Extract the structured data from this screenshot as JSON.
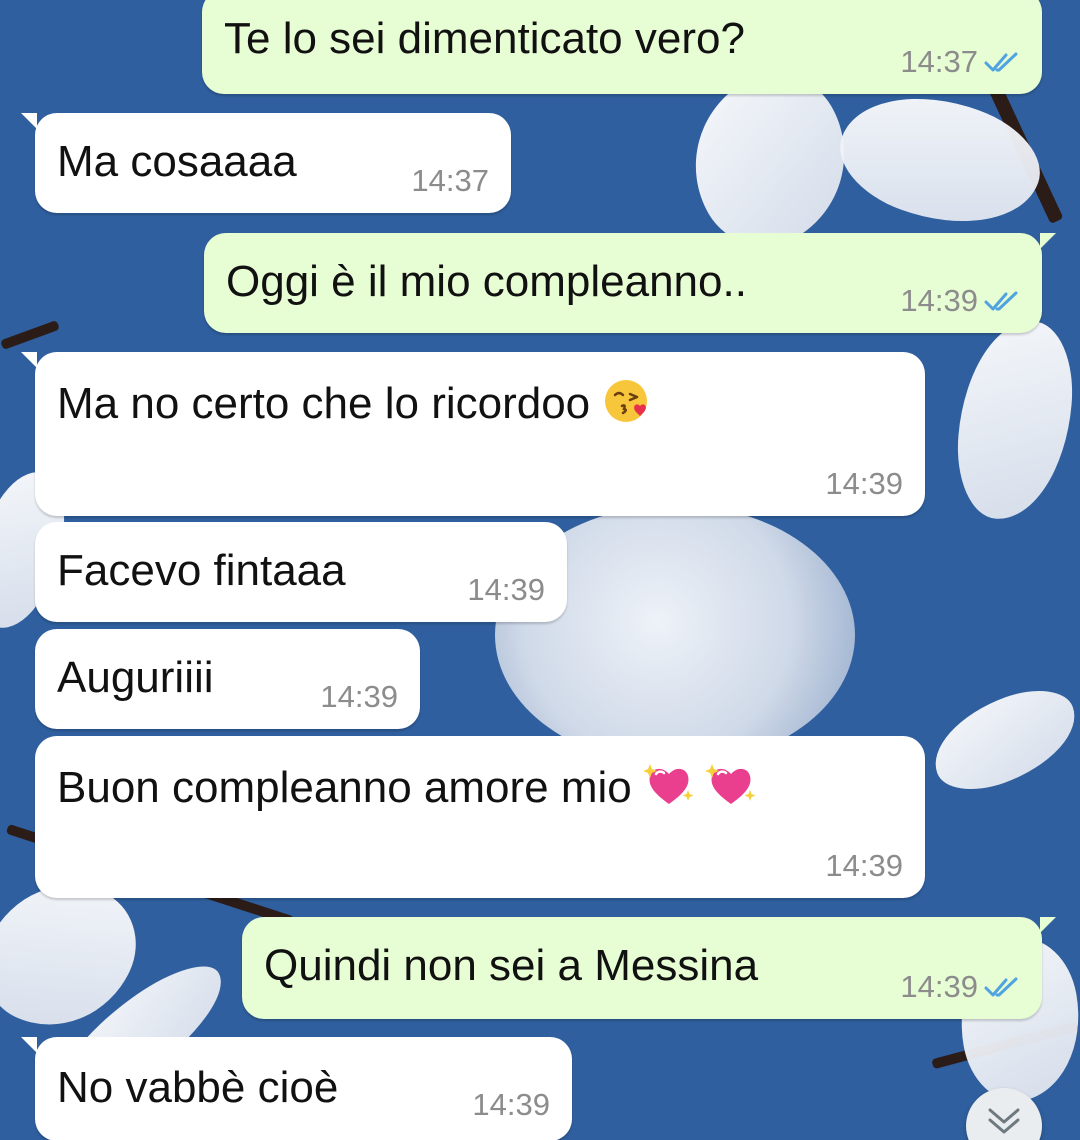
{
  "messages": [
    {
      "id": "m1",
      "direction": "outgoing",
      "text": "Te lo sei dimenticato vero?",
      "time": "14:37",
      "status": "read"
    },
    {
      "id": "m2",
      "direction": "incoming",
      "text": "Ma cosaaaa",
      "time": "14:37"
    },
    {
      "id": "m3",
      "direction": "outgoing",
      "text": "Oggi è il mio compleanno..",
      "time": "14:39",
      "status": "read"
    },
    {
      "id": "m4",
      "direction": "incoming",
      "text": "Ma no certo che lo ricordoo",
      "emoji": "face-blowing-kiss",
      "time": "14:39"
    },
    {
      "id": "m5",
      "direction": "incoming",
      "text": "Facevo fintaaa",
      "time": "14:39"
    },
    {
      "id": "m6",
      "direction": "incoming",
      "text": "Auguriiii",
      "time": "14:39"
    },
    {
      "id": "m7",
      "direction": "incoming",
      "text": "Buon compleanno amore mio",
      "emoji": "sparkling-heart x2",
      "time": "14:39"
    },
    {
      "id": "m8",
      "direction": "outgoing",
      "text": "Quindi non sei a Messina",
      "time": "14:39",
      "status": "read"
    },
    {
      "id": "m9",
      "direction": "incoming",
      "text": "No vabbè cioè",
      "time": "14:39"
    }
  ],
  "colors": {
    "outgoing_bubble": "#e7fdd4",
    "incoming_bubble": "#ffffff",
    "read_ticks": "#4fa3e0",
    "timestamp": "#8c8c8c",
    "wallpaper": "#2f5f9e"
  },
  "icons": {
    "read_receipt": "double-check-icon",
    "scroll_down": "chevron-double-down-icon"
  }
}
